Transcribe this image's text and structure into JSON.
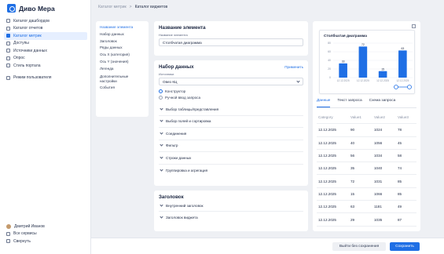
{
  "app": {
    "name": "Диво Мера"
  },
  "sidebar": {
    "items": [
      {
        "label": "Каталог дашбордов",
        "icon": "dashboard-icon"
      },
      {
        "label": "Каталог отчетов",
        "icon": "report-icon"
      },
      {
        "label": "Каталог метрик",
        "icon": "metrics-icon",
        "active": true
      },
      {
        "label": "Доступы",
        "icon": "access-icon"
      },
      {
        "label": "Источники данных",
        "icon": "database-icon"
      },
      {
        "label": "Опрос",
        "icon": "survey-icon"
      },
      {
        "label": "Стиль портала",
        "icon": "palette-icon"
      }
    ],
    "user_mode": "Режим пользователя",
    "user_name": "Дмитрий Иванов",
    "all_services": "Все сервисы",
    "collapse": "Свернуть"
  },
  "breadcrumb": {
    "parent": "Каталог метрик",
    "sep": ">",
    "current": "Каталог виджетов"
  },
  "settings_nav": [
    "Название элемента",
    "Набор данных",
    "Заголовок",
    "Ряды данных",
    "Ось X (категория)",
    "Ось Y (значения)",
    "Легенда",
    "Дополнительные настройки",
    "События"
  ],
  "element": {
    "title": "Название элемента",
    "label": "Название элемента",
    "value": "Столбчатая диаграмма"
  },
  "dataset": {
    "title": "Набор данных",
    "apply": "Применить",
    "source_label": "Источники",
    "source_value": "Овео КЦ",
    "mode_constructor": "Конструктор",
    "mode_manual": "Ручной ввод запроса",
    "sections": [
      "Выбор таблицы/представления",
      "Выбор полей и сортировка",
      "Соединения",
      "Фильтр",
      "Строки данных",
      "Группировка и агрегация"
    ]
  },
  "headers_block": {
    "title": "Заголовок",
    "sections": [
      "Внутренний заголовок",
      "Заголовок виджета"
    ]
  },
  "preview": {
    "tabs": [
      "Данные",
      "Текст запроса",
      "Схема запроса"
    ],
    "columns": [
      "Category",
      "Value1",
      "Value2",
      "Value3"
    ],
    "rows": [
      [
        "12.12.2025",
        "90",
        "1024",
        "78"
      ],
      [
        "12.12.2025",
        "40",
        "1056",
        "45"
      ],
      [
        "12.12.2025",
        "56",
        "1034",
        "58"
      ],
      [
        "12.12.2025",
        "35",
        "1040",
        "74"
      ],
      [
        "12.12.2025",
        "72",
        "1031",
        "85"
      ],
      [
        "12.12.2025",
        "15",
        "1066",
        "85"
      ],
      [
        "12.12.2025",
        "63",
        "1181",
        "49"
      ],
      [
        "12.12.2025",
        "29",
        "1035",
        "87"
      ]
    ]
  },
  "chart_data": {
    "type": "bar",
    "title": "Столбчатая диаграмма",
    "categories": [
      "12.12.2025",
      "12.12.2025",
      "12.12.2025",
      "12.12.2025"
    ],
    "values": [
      33,
      72,
      15,
      63
    ],
    "ylim": [
      0,
      80
    ],
    "yticks": [
      "80",
      "60",
      "40",
      "20",
      "0"
    ],
    "color": "#1f6fe5"
  },
  "footer": {
    "secondary": "Выйти без сохранения",
    "primary": "Сохранить"
  }
}
